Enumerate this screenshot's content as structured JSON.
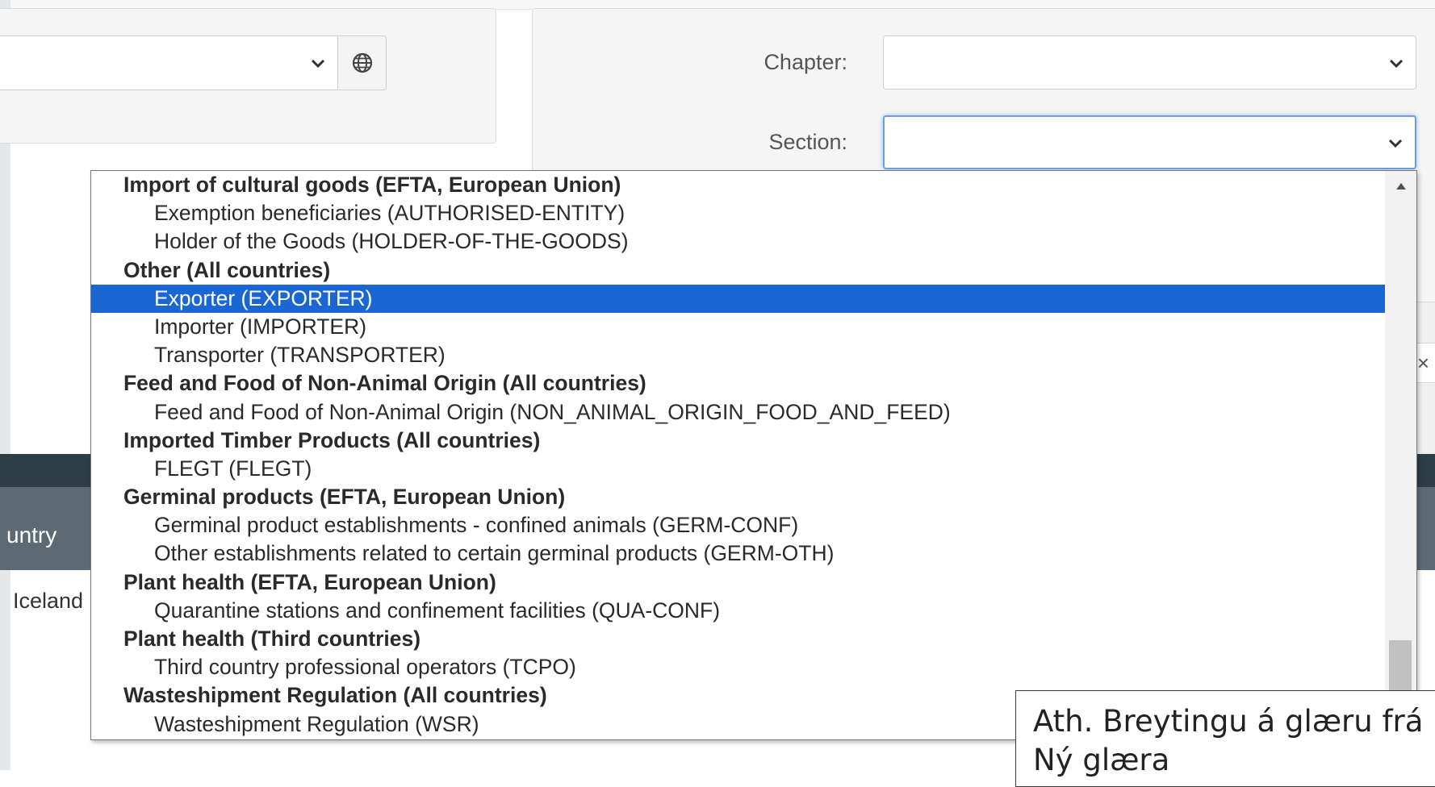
{
  "filters": {
    "chapter_label": "Chapter:",
    "section_label": "Section:",
    "chapter_value": "",
    "section_value": ""
  },
  "table": {
    "country_header": "untry",
    "first_row_country": "Iceland"
  },
  "clear_icon": "×",
  "dropdown": {
    "options": [
      {
        "type": "group",
        "label": "Import of cultural goods (EFTA, European Union)"
      },
      {
        "type": "item",
        "label": "Exemption beneficiaries (AUTHORISED-ENTITY)"
      },
      {
        "type": "item",
        "label": "Holder of the Goods (HOLDER-OF-THE-GOODS)"
      },
      {
        "type": "group",
        "label": "Other (All countries)"
      },
      {
        "type": "item",
        "label": "Exporter (EXPORTER)",
        "selected": true
      },
      {
        "type": "item",
        "label": "Importer (IMPORTER)"
      },
      {
        "type": "item",
        "label": "Transporter (TRANSPORTER)"
      },
      {
        "type": "group",
        "label": "Feed and Food of Non-Animal Origin (All countries)"
      },
      {
        "type": "item",
        "label": "Feed and Food of Non-Animal Origin (NON_ANIMAL_ORIGIN_FOOD_AND_FEED)"
      },
      {
        "type": "group",
        "label": "Imported Timber Products (All countries)"
      },
      {
        "type": "item",
        "label": "FLEGT (FLEGT)"
      },
      {
        "type": "group",
        "label": "Germinal products (EFTA, European Union)"
      },
      {
        "type": "item",
        "label": "Germinal product establishments - confined animals (GERM-CONF)"
      },
      {
        "type": "item",
        "label": "Other establishments related to certain germinal products (GERM-OTH)"
      },
      {
        "type": "group",
        "label": "Plant health (EFTA, European Union)"
      },
      {
        "type": "item",
        "label": "Quarantine stations and confinement facilities (QUA-CONF)"
      },
      {
        "type": "group",
        "label": "Plant health (Third countries)"
      },
      {
        "type": "item",
        "label": "Third country professional operators (TCPO)"
      },
      {
        "type": "group",
        "label": "Wasteshipment Regulation (All countries)"
      },
      {
        "type": "item",
        "label": "Wasteshipment Regulation (WSR)"
      }
    ]
  },
  "note": {
    "line1": "Ath. Breytingu á glæru frá",
    "line2": "Ný glæra"
  },
  "colors": {
    "selected_bg": "#1a66d2",
    "table_header": "#2f3d47",
    "table_subheader": "#5e6a73"
  }
}
